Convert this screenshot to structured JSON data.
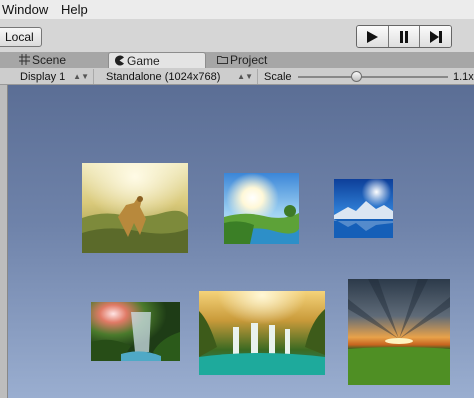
{
  "menu": {
    "window_label": "Window",
    "help_label": "Help"
  },
  "toolbar": {
    "local_label": "Local",
    "play_icon": "play-icon",
    "pause_icon": "pause-icon",
    "step_icon": "step-icon"
  },
  "tabs": [
    {
      "label": "Scene",
      "icon": "scene-grid-icon"
    },
    {
      "label": "Game",
      "icon": "game-pacman-icon",
      "active": true
    },
    {
      "label": "Project",
      "icon": "folder-icon"
    }
  ],
  "game_bar": {
    "display": "Display 1",
    "resolution": "Standalone (1024x768)",
    "scale_label": "Scale",
    "scale_value": "1.1x"
  },
  "colors": {
    "viewport_top": "#5b6e95",
    "viewport_bottom": "#9aaed0",
    "menu_bg": "#ececec",
    "toolbar_bg": "#d6d6d6"
  },
  "images": [
    {
      "name": "cheetah-savanna"
    },
    {
      "name": "sunny-river-field"
    },
    {
      "name": "mountain-lake-sunburst"
    },
    {
      "name": "jungle-waterfall-sunbeams"
    },
    {
      "name": "golden-waterfall-pool"
    },
    {
      "name": "sunset-green-field"
    }
  ]
}
